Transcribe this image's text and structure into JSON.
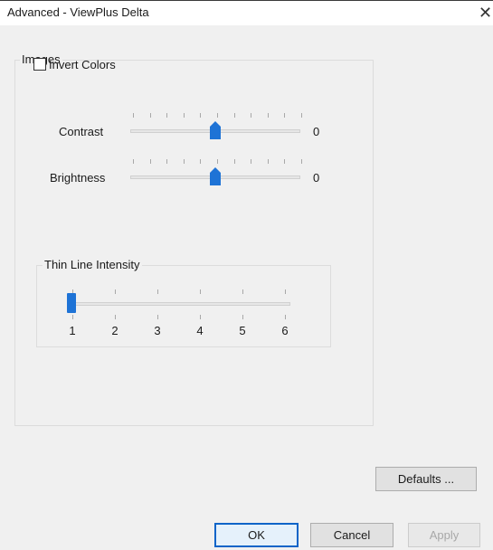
{
  "window": {
    "title": "Advanced - ViewPlus Delta",
    "close_glyph": "✕"
  },
  "images_group": {
    "caption": "Images",
    "invert_colors": {
      "label": "Invert Colors",
      "checked": false
    },
    "contrast": {
      "label": "Contrast",
      "value_text": "0",
      "min": -10,
      "max": 10,
      "value": 0
    },
    "brightness": {
      "label": "Brightness",
      "value_text": "0",
      "min": -10,
      "max": 10,
      "value": 0
    }
  },
  "thin_line_group": {
    "caption": "Thin Line Intensity",
    "levels": [
      "1",
      "2",
      "3",
      "4",
      "5",
      "6"
    ],
    "value": 1
  },
  "buttons": {
    "defaults": {
      "label": "Defaults ..."
    },
    "ok": {
      "label": "OK"
    },
    "cancel": {
      "label": "Cancel"
    },
    "apply": {
      "label": "Apply",
      "enabled": false
    }
  },
  "colors": {
    "accent": "#1e73d6",
    "dialog_bg": "#f0f0f0",
    "button_bg": "#e1e1e1"
  }
}
